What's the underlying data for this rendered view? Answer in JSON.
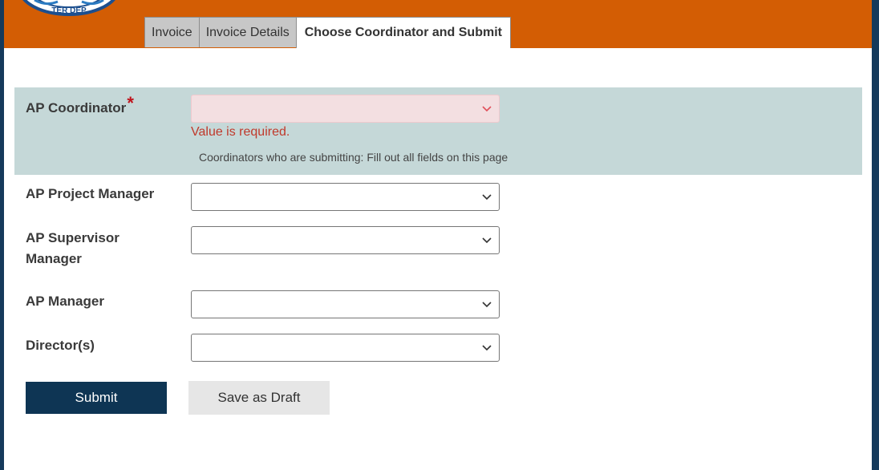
{
  "tabs": [
    {
      "label": "Invoice"
    },
    {
      "label": "Invoice Details"
    },
    {
      "label": "Choose Coordinator and Submit"
    }
  ],
  "logo": {
    "text": "TER DEP"
  },
  "form": {
    "ap_coordinator": {
      "label": "AP Coordinator",
      "required_marker": "*",
      "value": "",
      "error": "Value is required."
    },
    "hint": "Coordinators who are submitting: Fill out all fields on this page",
    "ap_project_manager": {
      "label": "AP Project Manager",
      "value": ""
    },
    "ap_supervisor_manager": {
      "label_line1": "AP Supervisor",
      "label_line2": "Manager",
      "value": ""
    },
    "ap_manager": {
      "label": "AP Manager",
      "value": ""
    },
    "directors": {
      "label": "Director(s)",
      "value": ""
    }
  },
  "buttons": {
    "submit": "Submit",
    "save_draft": "Save as Draft"
  },
  "colors": {
    "header": "#d35d04",
    "panel": "#c5d8d8",
    "submit": "#0e3554",
    "error": "#c0392b",
    "required": "#c0121b"
  },
  "icons": {
    "dropdown": "chevron-down-icon",
    "logo": "seal-logo"
  }
}
